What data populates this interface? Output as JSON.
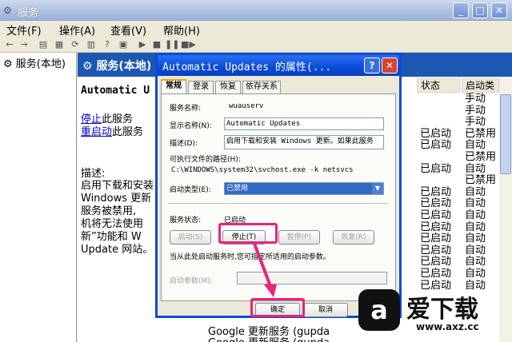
{
  "window": {
    "title": "服务",
    "min": "_",
    "max": "□",
    "close": "✕"
  },
  "menu": [
    "文件(F)",
    "操作(A)",
    "查看(V)",
    "帮助(H)"
  ],
  "tree": {
    "root_label": "服务(本地)"
  },
  "main": {
    "header_title": "服务(本地)",
    "service_name": "Automatic U",
    "stop_link": "停止",
    "stop_suffix": "此服务",
    "restart_link": "重启动",
    "restart_suffix": "此服务",
    "desc_heading": "描述:",
    "desc_lines": [
      "启用下载和安装",
      "Windows 更新",
      "服务被禁用,",
      "机将无法使用",
      "新”功能和 W",
      "Update 网站。"
    ]
  },
  "columns": {
    "status": "状态",
    "startup": "启动类"
  },
  "list_rows": [
    {
      "status": "",
      "startup": "手动"
    },
    {
      "status": "",
      "startup": "手动"
    },
    {
      "status": "",
      "startup": "手动"
    },
    {
      "status": "已启动",
      "startup": "已禁用"
    },
    {
      "status": "已启动",
      "startup": "自动"
    },
    {
      "status": "",
      "startup": "已禁用"
    },
    {
      "status": "已启动",
      "startup": "自动"
    },
    {
      "status": "",
      "startup": "已禁用"
    },
    {
      "status": "已启动",
      "startup": "自动"
    },
    {
      "status": "已启动",
      "startup": "自动"
    },
    {
      "status": "已启动",
      "startup": "自动"
    },
    {
      "status": "已启动",
      "startup": "自动"
    },
    {
      "status": "已启动",
      "startup": "自动"
    },
    {
      "status": "已启动",
      "startup": "自动"
    },
    {
      "status": "已启动",
      "startup": "自动"
    },
    {
      "status": "已启动",
      "startup": "自动"
    },
    {
      "status": "已启动",
      "startup": "自动"
    }
  ],
  "bottom_rows": [
    "Google 更新服务 (gupda",
    "Google 更新服务 (gupda"
  ],
  "dialog": {
    "title": "Automatic Updates 的属性(...",
    "help": "?",
    "close": "✕",
    "tabs": [
      "常规",
      "登录",
      "恢复",
      "依存关系"
    ],
    "service_name_label": "服务名称:",
    "service_name_value": "wuauserv",
    "display_name_label": "显示名称(N):",
    "display_name_value": "Automatic Updates",
    "desc_label": "描述(D):",
    "desc_value": "启用下载和安装 Windows 更新。如果此服务",
    "path_label": "可执行文件的路径(H):",
    "path_value": "C:\\WINDOWS\\system32\\svchost.exe -k netsvcs",
    "startup_label": "启动类型(E):",
    "startup_value": "已禁用",
    "status_label": "服务状态:",
    "status_value": "已启动",
    "btn_start": "启动(S)",
    "btn_stop": "停止(T)",
    "btn_pause": "暂停(P)",
    "btn_resume": "恢复(R)",
    "hint": "当从此处启动服务时,您可指定所适用的启动参数。",
    "params_label": "启动参数(M):",
    "btn_ok": "确定",
    "btn_cancel": "取消"
  },
  "watermark": {
    "logo_char": "a",
    "text": "爱下载",
    "url": "www.axz.cc"
  },
  "colors": {
    "highlight": "#e8257a",
    "xp_blue": "#0a4bd6"
  }
}
